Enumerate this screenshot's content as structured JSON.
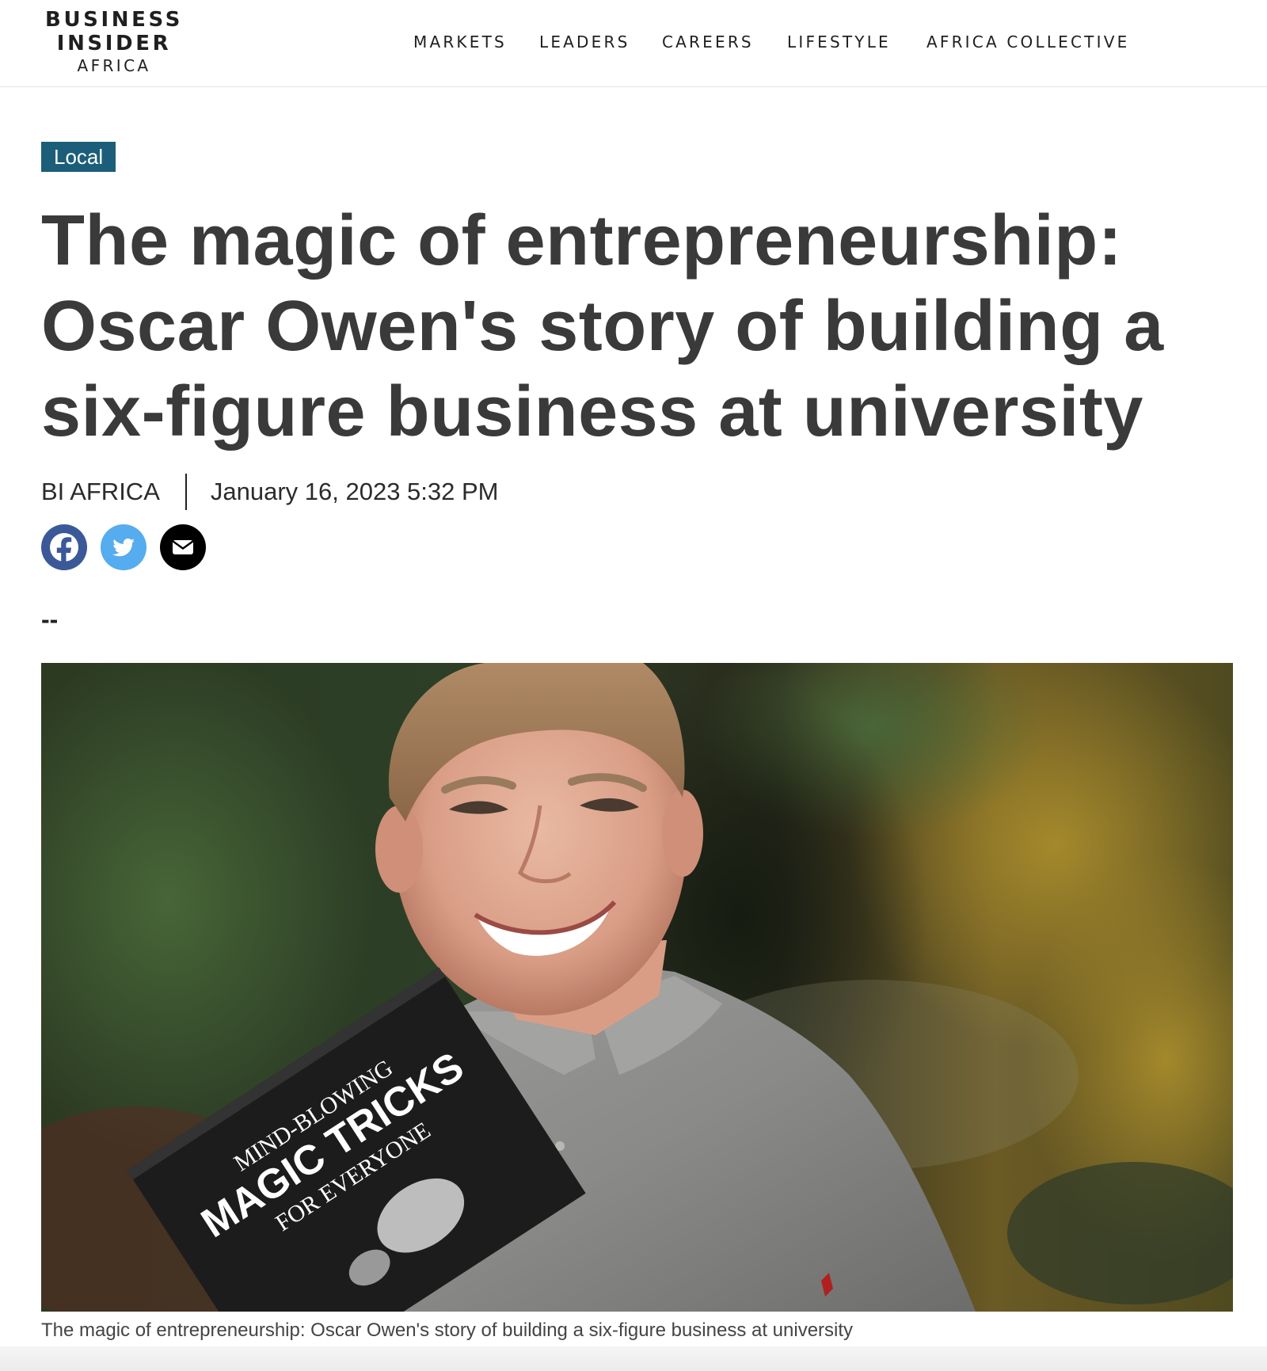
{
  "header": {
    "logo": {
      "line1": "BUSINESS",
      "line2": "INSIDER",
      "line3": "AFRICA"
    },
    "nav": [
      {
        "label": "MARKETS"
      },
      {
        "label": "LEADERS"
      },
      {
        "label": "CAREERS"
      },
      {
        "label": "LIFESTYLE"
      },
      {
        "label": "AFRICA COLLECTIVE"
      }
    ]
  },
  "article": {
    "category": "Local",
    "headline": "The magic of entrepreneurship: Oscar Owen's story of building a six-figure business at university",
    "author": "BI AFRICA",
    "date": "January 16, 2023 5:32 PM",
    "share": [
      {
        "icon": "facebook-icon",
        "color": "#3b5998"
      },
      {
        "icon": "twitter-icon",
        "color": "#55acee"
      },
      {
        "icon": "email-icon",
        "color": "#000000"
      }
    ],
    "separator": "--",
    "image": {
      "book_line1": "MIND-BLOWING",
      "book_line2": "MAGIC TRICKS",
      "book_line3": "FOR EVERYONE"
    },
    "caption": "The magic of entrepreneurship: Oscar Owen's story of building a six-figure business at university"
  },
  "colors": {
    "category_badge": "#1c5e79",
    "headline": "#3a3a3a"
  }
}
